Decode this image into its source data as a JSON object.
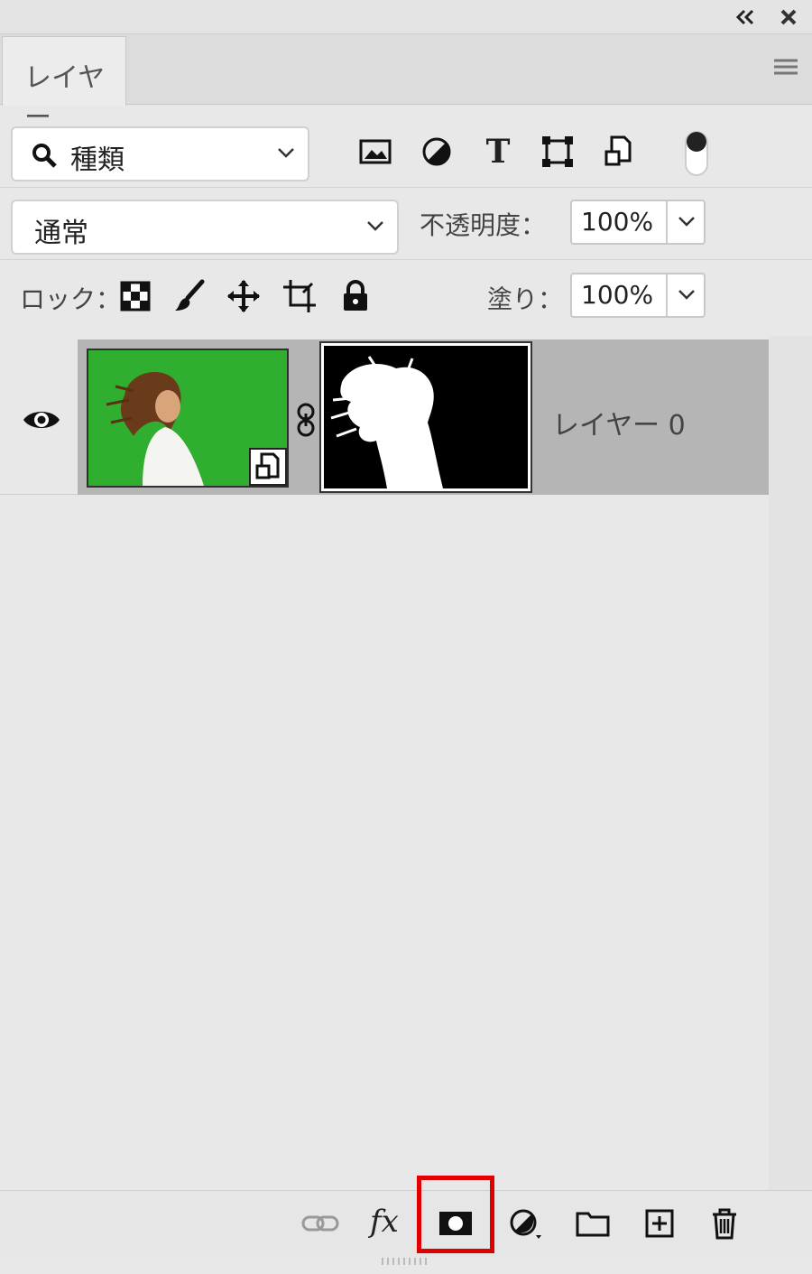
{
  "panel": {
    "tab_label": "レイヤー",
    "collapse_glyph": "‹‹",
    "close_glyph": "✖"
  },
  "filter": {
    "kind_label": "種類",
    "icons": [
      "pixel-layer-filter-icon",
      "adjustment-layer-filter-icon",
      "type-layer-filter-icon",
      "shape-layer-filter-icon",
      "smart-object-filter-icon"
    ],
    "type_glyph": "T"
  },
  "blend": {
    "mode": "通常",
    "opacity_label": "不透明度：",
    "opacity_value": "100%"
  },
  "lock": {
    "label": "ロック：",
    "fill_label": "塗り：",
    "fill_value": "100%"
  },
  "layers": [
    {
      "name": "レイヤー 0",
      "visible": true,
      "thumb_bg": "#2fae2f"
    }
  ],
  "bottom": {
    "fx_label": "fx",
    "highlighted": "add-layer-mask-button",
    "highlight_color": "#e00000"
  }
}
